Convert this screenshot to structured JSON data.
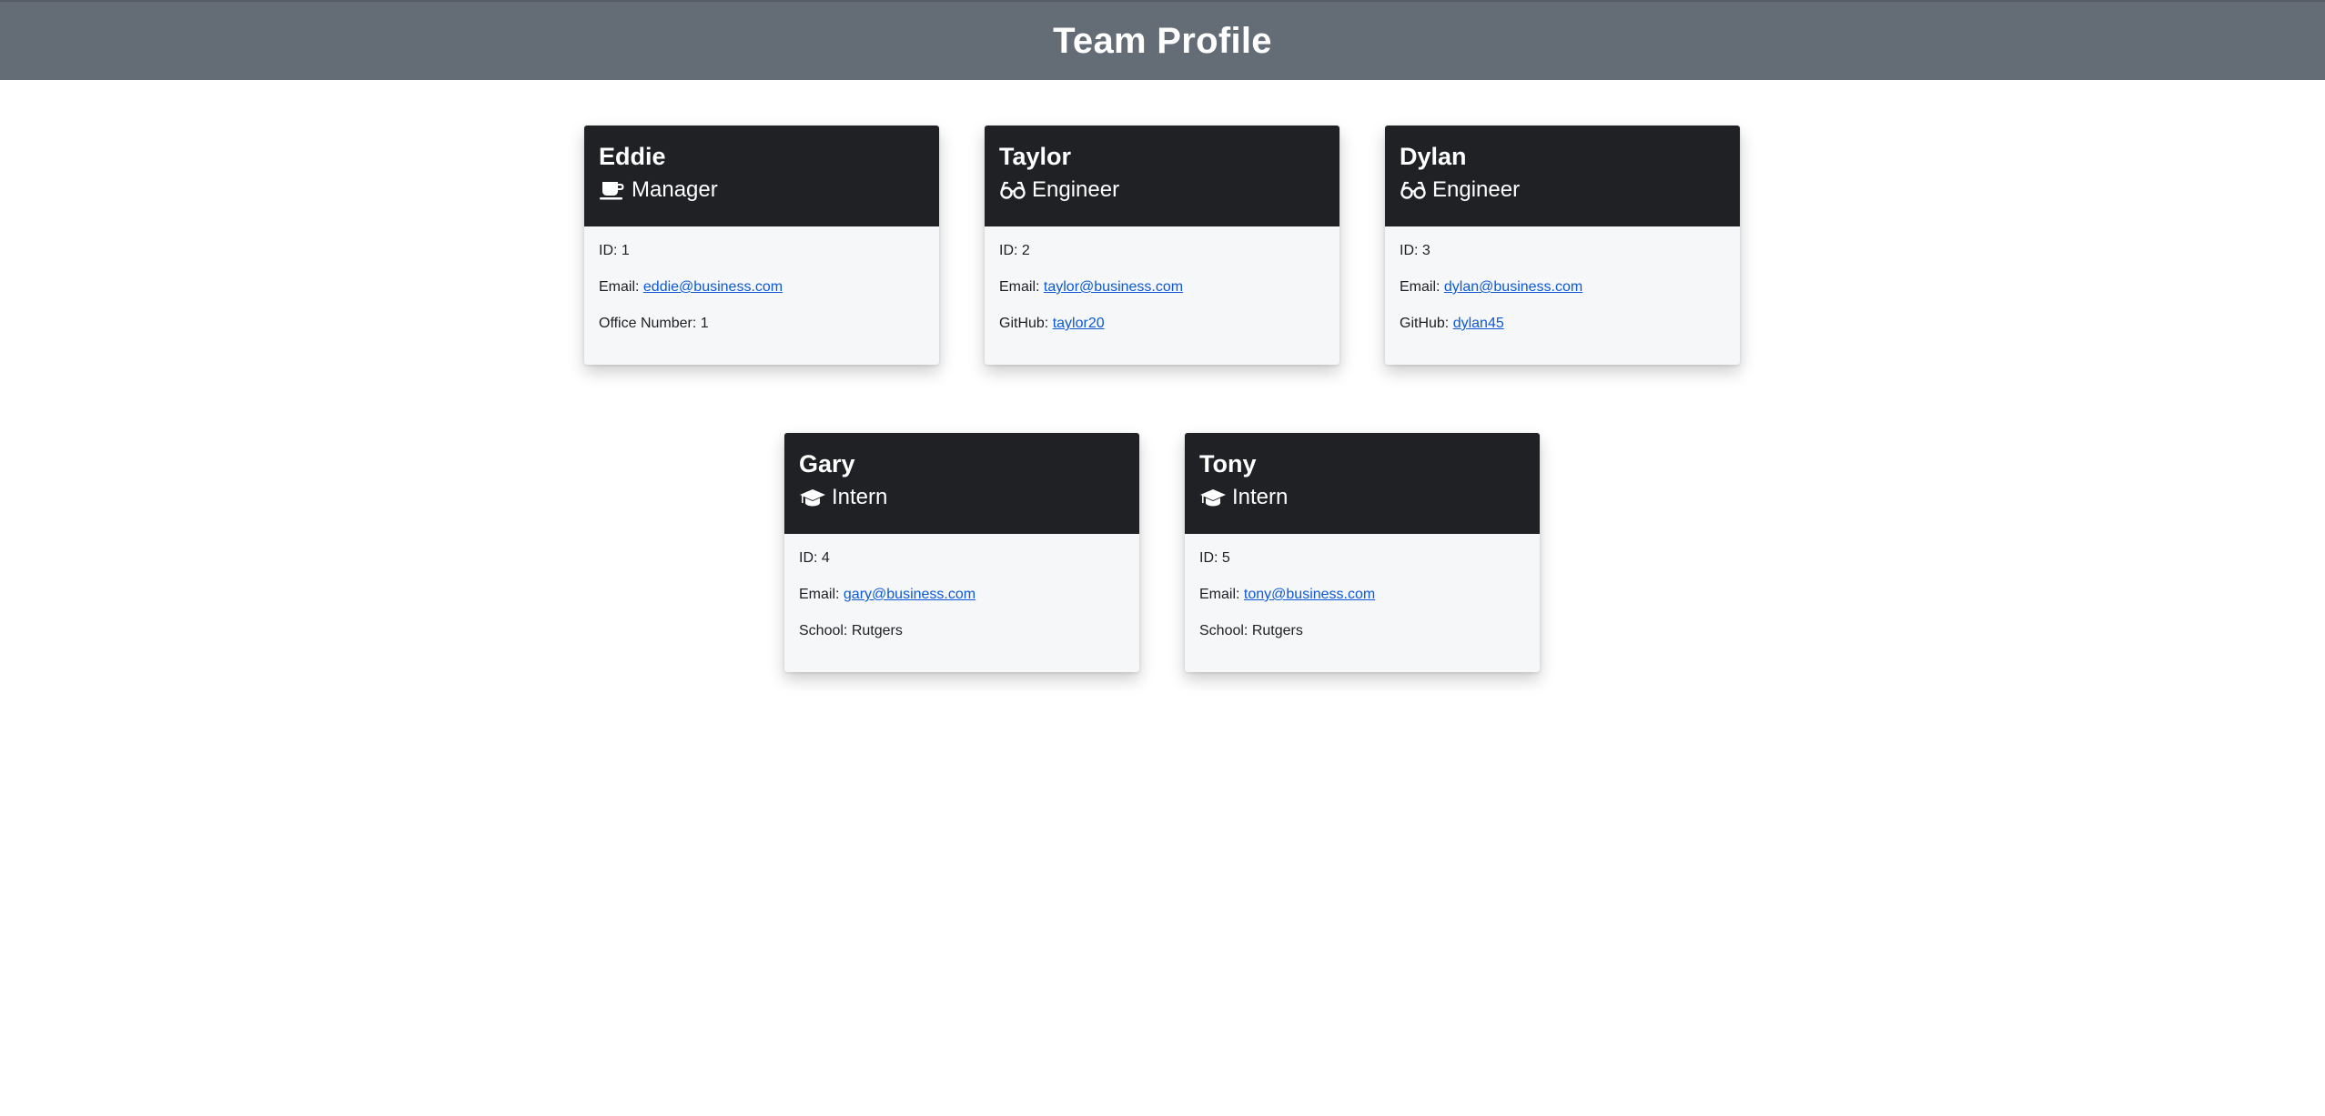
{
  "page": {
    "title": "Team Profile"
  },
  "team": [
    {
      "name": "Eddie",
      "role": "Manager",
      "role_icon": "coffee-mug-icon",
      "id_label": "ID: 1",
      "email_label": "Email: ",
      "email": "eddie@business.com",
      "extra_label": "Office Number: ",
      "extra_value": "1"
    },
    {
      "name": "Taylor",
      "role": "Engineer",
      "role_icon": "glasses-icon",
      "id_label": "ID: 2",
      "email_label": "Email: ",
      "email": "taylor@business.com",
      "extra_label": "GitHub: ",
      "extra_value": "taylor20"
    },
    {
      "name": "Dylan",
      "role": "Engineer",
      "role_icon": "glasses-icon",
      "id_label": "ID: 3",
      "email_label": "Email: ",
      "email": "dylan@business.com",
      "extra_label": "GitHub: ",
      "extra_value": "dylan45"
    },
    {
      "name": "Gary",
      "role": "Intern",
      "role_icon": "graduation-cap-icon",
      "id_label": "ID: 4",
      "email_label": "Email: ",
      "email": "gary@business.com",
      "extra_label": "School: ",
      "extra_value": "Rutgers"
    },
    {
      "name": "Tony",
      "role": "Intern",
      "role_icon": "graduation-cap-icon",
      "id_label": "ID: 5",
      "email_label": "Email: ",
      "email": "tony@business.com",
      "extra_label": "School: ",
      "extra_value": "Rutgers"
    }
  ],
  "colors": {
    "header_bg": "#646c76",
    "card_head_bg": "#1f2125",
    "card_body_bg": "#f6f7f9",
    "link": "#0d59d8"
  }
}
